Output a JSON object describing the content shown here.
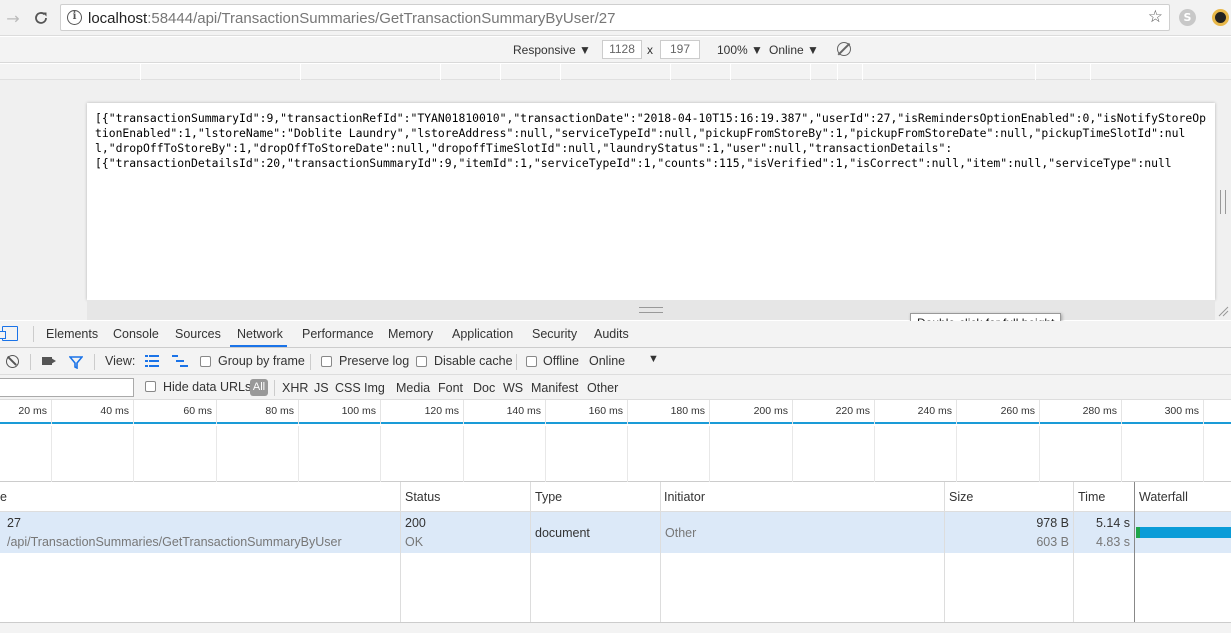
{
  "browser": {
    "url_host": "localhost",
    "url_rest": ":58444/api/TransactionSummaries/GetTransactionSummaryByUser/27"
  },
  "device_toolbar": {
    "mode": "Responsive ▼",
    "width": "1128",
    "times": "x",
    "height": "197",
    "zoom": "100% ▼",
    "network": "Online ▼"
  },
  "page": {
    "json_text": "[{\"transactionSummaryId\":9,\"transactionRefId\":\"TYAN01810010\",\"transactionDate\":\"2018-04-10T15:16:19.387\",\"userId\":27,\"isRemindersOptionEnabled\":0,\"isNotifyStoreOptionEnabled\":1,\"lstoreName\":\"Doblite Laundry\",\"lstoreAddress\":null,\"serviceTypeId\":null,\"pickupFromStoreBy\":1,\"pickupFromStoreDate\":null,\"pickupTimeSlotId\":null,\"dropOffToStoreBy\":1,\"dropOffToStoreDate\":null,\"dropoffTimeSlotId\":null,\"laundryStatus\":1,\"user\":null,\"transactionDetails\":\n[{\"transactionDetailsId\":20,\"transactionSummaryId\":9,\"itemId\":1,\"serviceTypeId\":1,\"counts\":115,\"isVerified\":1,\"isCorrect\":null,\"item\":null,\"serviceType\":null"
  },
  "tooltip": "Double-click for full height",
  "devtools": {
    "tabs": [
      "Elements",
      "Console",
      "Sources",
      "Network",
      "Performance",
      "Memory",
      "Application",
      "Security",
      "Audits"
    ],
    "active_tab": "Network",
    "toolbar": {
      "view": "View:",
      "group_by_frame": "Group by frame",
      "preserve_log": "Preserve log",
      "disable_cache": "Disable cache",
      "offline": "Offline",
      "throttle": "Online"
    },
    "filter": {
      "hide_data_urls": "Hide data URLs",
      "all": "All",
      "types": [
        "XHR",
        "JS",
        "CSS",
        "Img",
        "Media",
        "Font",
        "Doc",
        "WS",
        "Manifest",
        "Other"
      ]
    },
    "timeline_ticks": [
      "20 ms",
      "40 ms",
      "60 ms",
      "80 ms",
      "100 ms",
      "120 ms",
      "140 ms",
      "160 ms",
      "180 ms",
      "200 ms",
      "220 ms",
      "240 ms",
      "260 ms",
      "280 ms",
      "300 ms"
    ],
    "columns": {
      "name": "e",
      "status": "Status",
      "type": "Type",
      "initiator": "Initiator",
      "size": "Size",
      "time": "Time",
      "waterfall": "Waterfall"
    },
    "requests": [
      {
        "name": "27",
        "path": "/api/TransactionSummaries/GetTransactionSummaryByUser",
        "status_code": "200",
        "status_text": "OK",
        "type": "document",
        "initiator": "Other",
        "size": "978 B",
        "content": "603 B",
        "time": "5.14 s",
        "latency": "4.83 s"
      }
    ]
  }
}
